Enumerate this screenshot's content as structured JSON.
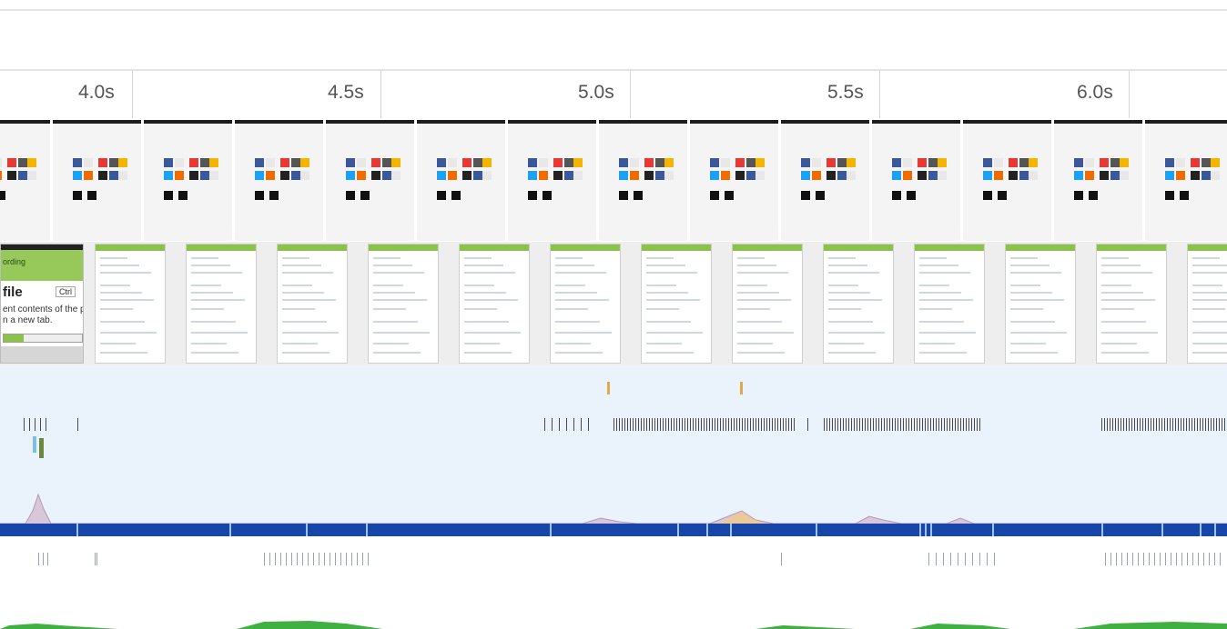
{
  "timeline": {
    "ticks": [
      "4.0s",
      "4.5s",
      "5.0s",
      "5.5s",
      "6.0s"
    ]
  },
  "recording_popup": {
    "banner": "ording",
    "title": "file",
    "shortcut": "Ctrl",
    "description_line1": "ent contents of the p",
    "description_line2": "n a new tab.",
    "progress_fraction": 0.25
  },
  "colors": {
    "frame_border": "#1c1c1c",
    "main_track_bg": "#eaf2fb",
    "network_bar": "#1845a8",
    "accent_green": "#8bc34a"
  }
}
